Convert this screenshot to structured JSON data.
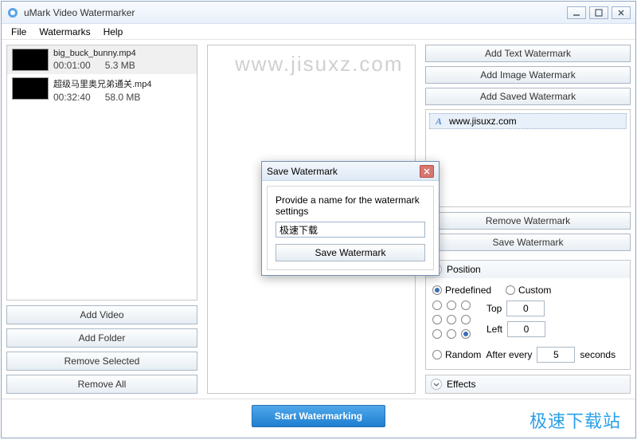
{
  "window": {
    "title": "uMark Video Watermarker"
  },
  "menu": {
    "file": "File",
    "watermarks": "Watermarks",
    "help": "Help"
  },
  "videos": [
    {
      "name": "big_buck_bunny.mp4",
      "duration": "00:01:00",
      "size": "5.3 MB"
    },
    {
      "name": "超级马里奥兄弟通关.mp4",
      "duration": "00:32:40",
      "size": "58.0 MB"
    }
  ],
  "left_buttons": {
    "add_video": "Add Video",
    "add_folder": "Add Folder",
    "remove_selected": "Remove Selected",
    "remove_all": "Remove All"
  },
  "preview": {
    "watermark_overlay": "www.jisuxz.com"
  },
  "right_buttons": {
    "add_text": "Add Text Watermark",
    "add_image": "Add Image Watermark",
    "add_saved": "Add Saved Watermark",
    "remove": "Remove Watermark",
    "save": "Save Watermark"
  },
  "watermark_list": [
    {
      "label": "www.jisuxz.com"
    }
  ],
  "position": {
    "header": "Position",
    "predefined_label": "Predefined",
    "custom_label": "Custom",
    "top_label": "Top",
    "left_label": "Left",
    "top_value": "0",
    "left_value": "0",
    "random_label": "Random",
    "after_every": "After every",
    "seconds": "seconds",
    "interval": "5",
    "mode": "predefined",
    "grid_selected": 8
  },
  "effects": {
    "header": "Effects"
  },
  "bottom": {
    "start": "Start Watermarking"
  },
  "modal": {
    "title": "Save Watermark",
    "prompt": "Provide a name for the watermark settings",
    "input_value": "极速下载",
    "button": "Save Watermark"
  },
  "site_tag": "极速下载站"
}
